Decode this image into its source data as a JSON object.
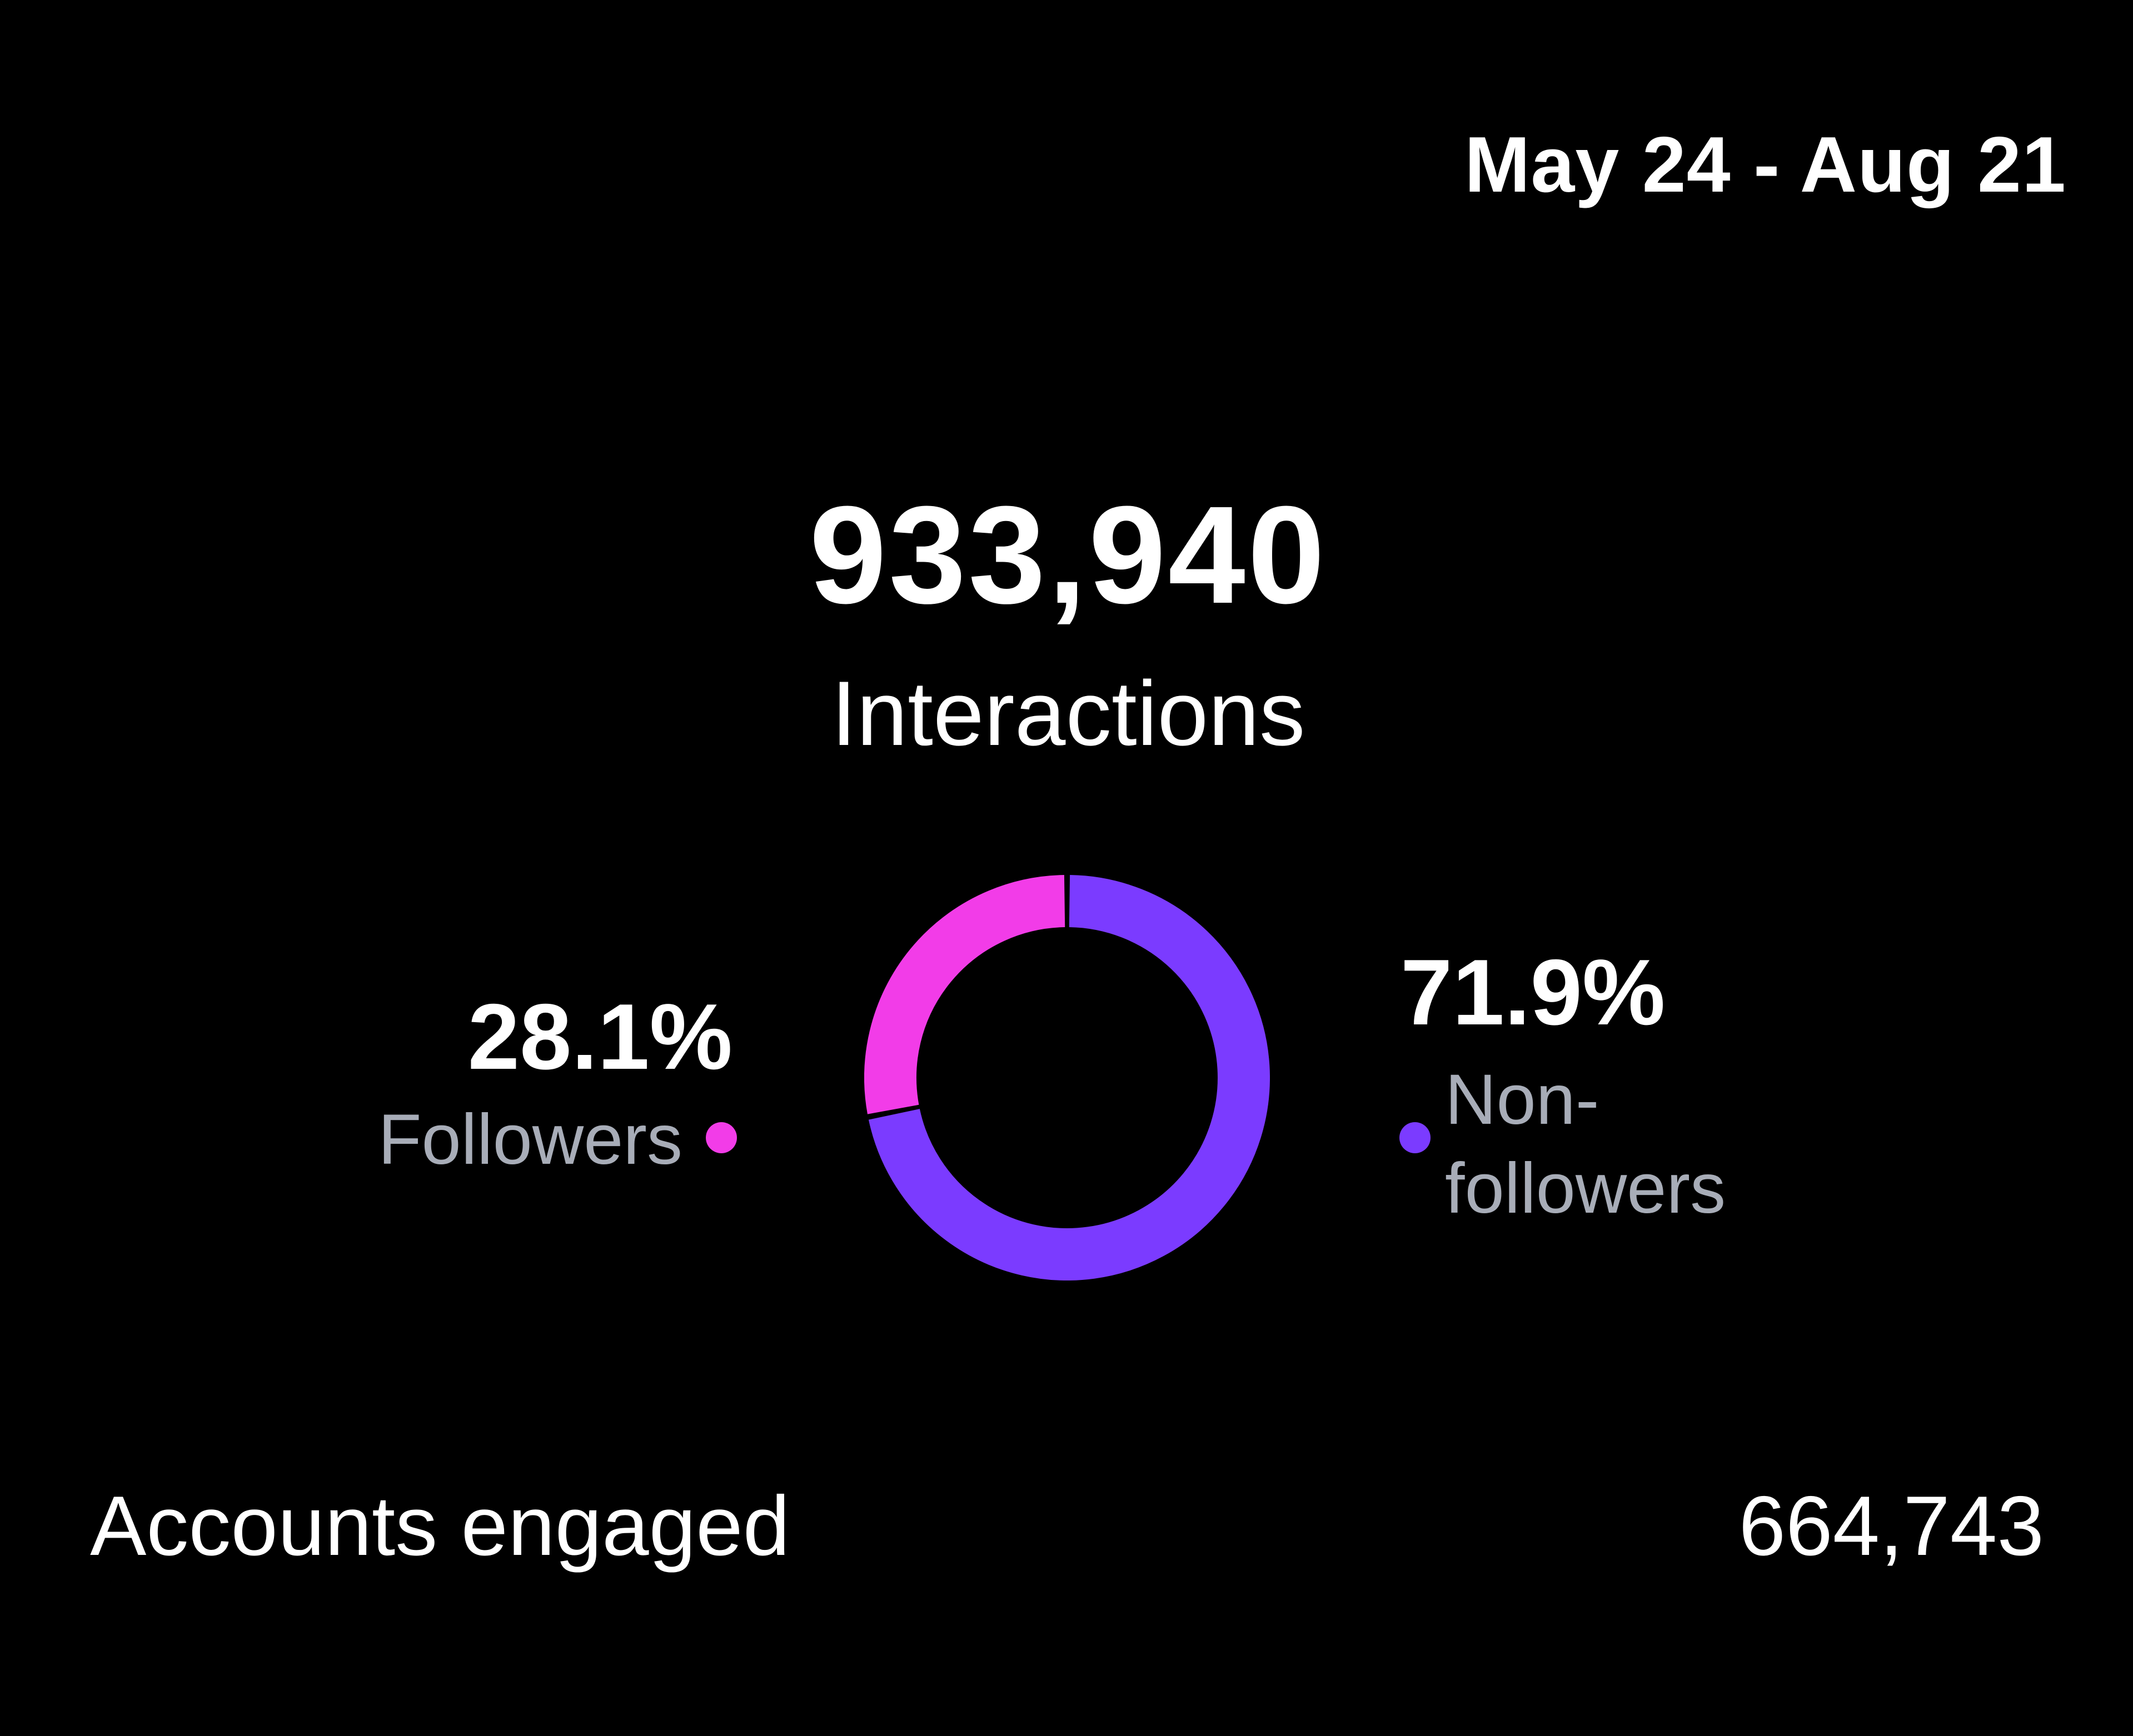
{
  "header": {
    "date_range": "May 24 - Aug 21"
  },
  "summary": {
    "total_value": "933,940",
    "total_label": "Interactions"
  },
  "colors": {
    "followers": "#f23ce8",
    "non_followers": "#7b3bff",
    "background": "#000000",
    "legend_text": "#a8adb8"
  },
  "chart_data": {
    "type": "pie",
    "categories": [
      "Followers",
      "Non-followers"
    ],
    "values": [
      28.1,
      71.9
    ],
    "labels": [
      "28.1%",
      "71.9%"
    ],
    "style": "donut"
  },
  "legend": {
    "followers_pct": "28.1%",
    "followers_label": "Followers",
    "non_followers_pct": "71.9%",
    "non_followers_label_line1": "Non-",
    "non_followers_label_line2": "followers"
  },
  "footer": {
    "label": "Accounts engaged",
    "value": "664,743"
  }
}
